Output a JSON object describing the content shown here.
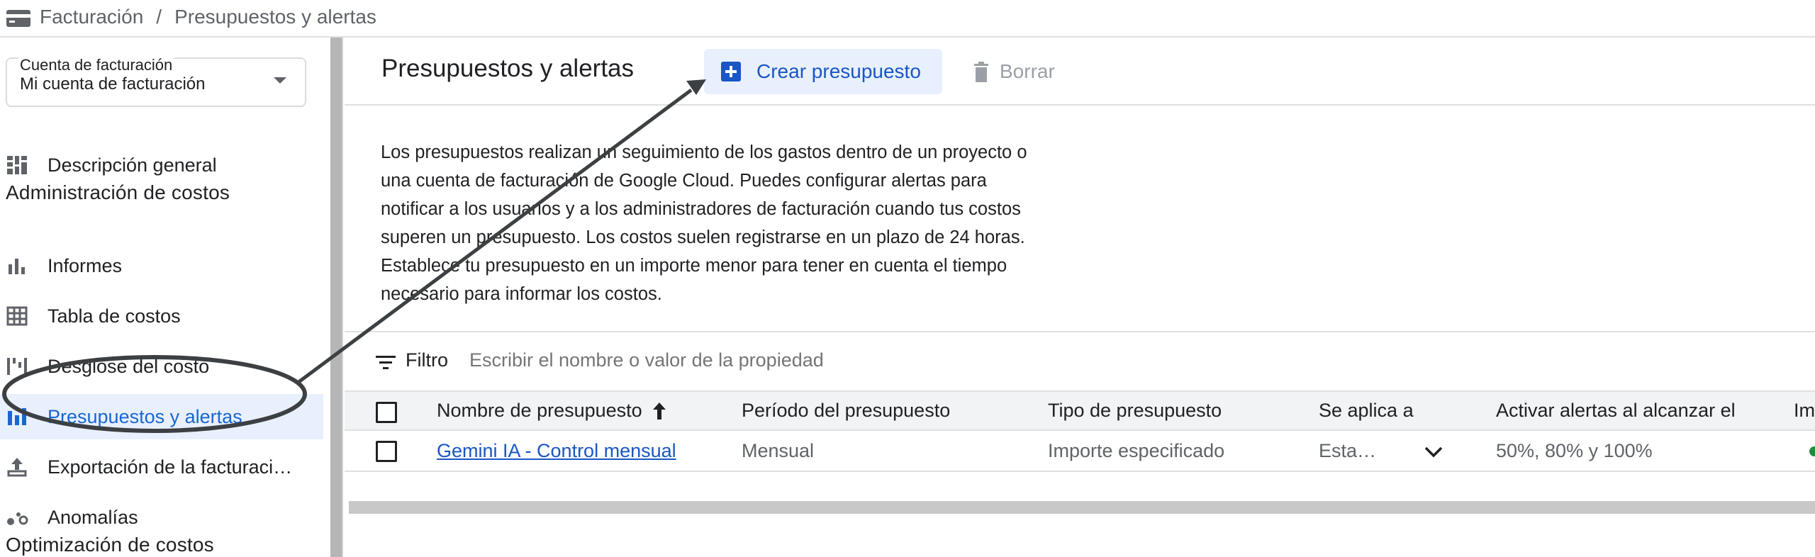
{
  "breadcrumb": {
    "icon": "billing-card-icon",
    "root": "Facturación",
    "separator": "/",
    "current": "Presupuestos y alertas"
  },
  "sidebar": {
    "account_selector": {
      "label": "Cuenta de facturación",
      "value": "Mi cuenta de facturación"
    },
    "items": [
      {
        "label": "Descripción general",
        "icon": "dashboard-icon"
      },
      {
        "section": "Administración de costos"
      },
      {
        "label": "Informes",
        "icon": "bar-chart-icon"
      },
      {
        "label": "Tabla de costos",
        "icon": "table-icon"
      },
      {
        "label": "Desglose del costo",
        "icon": "waterfall-chart-icon"
      },
      {
        "label": "Presupuestos y alertas",
        "icon": "budget-chart-icon",
        "active": true
      },
      {
        "label": "Exportación de la facturaci…",
        "icon": "upload-icon"
      },
      {
        "label": "Anomalías",
        "icon": "anomaly-icon"
      },
      {
        "section": "Optimización de costos"
      }
    ]
  },
  "main": {
    "title": "Presupuestos y alertas",
    "create_button": "Crear presupuesto",
    "delete_button": "Borrar",
    "description_lines": [
      "Los presupuestos realizan un seguimiento de los gastos dentro de un proyecto o",
      "una cuenta de facturación de Google Cloud. Puedes configurar alertas para",
      "notificar a los usuarios y a los administradores de facturación cuando tus costos",
      "superen un presupuesto. Los costos suelen registrarse en un plazo de 24 horas.",
      "Establece tu presupuesto en un importe menor para tener en cuenta el tiempo",
      "necesario para informar los costos."
    ],
    "filter": {
      "label": "Filtro",
      "placeholder": "Escribir el nombre o valor de la propiedad"
    },
    "table": {
      "columns": [
        "Nombre de presupuesto",
        "Período del presupuesto",
        "Tipo de presupuesto",
        "Se aplica a",
        "Activar alertas al alcanzar el",
        "Im"
      ],
      "rows": [
        {
          "name": "Gemini IA - Control mensual",
          "period": "Mensual",
          "type": "Importe especificado",
          "applies_to": "Esta…",
          "alerts": "50%, 80% y 100%"
        }
      ]
    }
  },
  "colors": {
    "accent": "#1a56c4",
    "active_bg": "#e8f0fe",
    "annotation": "#3c4043"
  }
}
